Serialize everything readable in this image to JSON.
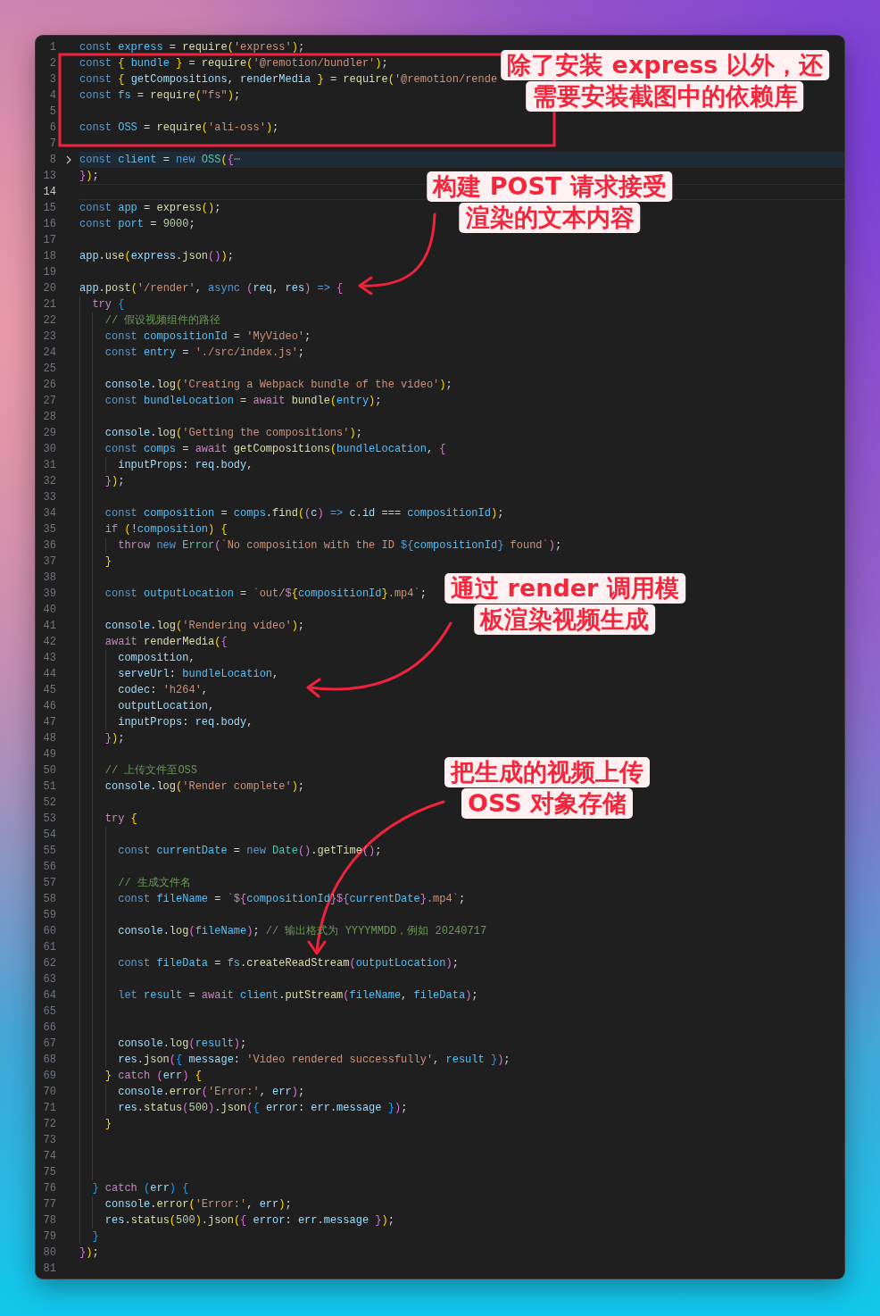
{
  "lines": [
    {
      "number": "1",
      "folded": false,
      "current": false,
      "tokens": [
        {
          "kind": "k",
          "text": "const "
        },
        {
          "kind": "n",
          "text": "express"
        },
        {
          "kind": "p",
          "text": " = "
        },
        {
          "kind": "f",
          "text": "require"
        },
        {
          "kind": "b1",
          "text": "("
        },
        {
          "kind": "s",
          "text": "'express'"
        },
        {
          "kind": "b1",
          "text": ")"
        },
        {
          "kind": "p",
          "text": ";"
        }
      ]
    },
    {
      "number": "2",
      "folded": false,
      "current": false,
      "tokens": [
        {
          "kind": "k",
          "text": "const "
        },
        {
          "kind": "b1",
          "text": "{ "
        },
        {
          "kind": "n",
          "text": "bundle "
        },
        {
          "kind": "b1",
          "text": "}"
        },
        {
          "kind": "p",
          "text": " = "
        },
        {
          "kind": "f",
          "text": "require"
        },
        {
          "kind": "b1",
          "text": "("
        },
        {
          "kind": "s",
          "text": "'@remotion/bundler'"
        },
        {
          "kind": "b1",
          "text": ")"
        },
        {
          "kind": "p",
          "text": ";"
        }
      ]
    },
    {
      "number": "3",
      "folded": false,
      "current": false,
      "tokens": [
        {
          "kind": "k",
          "text": "const "
        },
        {
          "kind": "b1",
          "text": "{ "
        },
        {
          "kind": "v",
          "text": "getCompositions"
        },
        {
          "kind": "p",
          "text": ", "
        },
        {
          "kind": "v",
          "text": "renderMedia "
        },
        {
          "kind": "b1",
          "text": "}"
        },
        {
          "kind": "p",
          "text": " = "
        },
        {
          "kind": "f",
          "text": "require"
        },
        {
          "kind": "b1",
          "text": "("
        },
        {
          "kind": "s",
          "text": "'@remotion/rende"
        }
      ]
    },
    {
      "number": "4",
      "folded": false,
      "current": false,
      "tokens": [
        {
          "kind": "k",
          "text": "const "
        },
        {
          "kind": "n",
          "text": "fs"
        },
        {
          "kind": "p",
          "text": " = "
        },
        {
          "kind": "f",
          "text": "require"
        },
        {
          "kind": "b1",
          "text": "("
        },
        {
          "kind": "s",
          "text": "\"fs\""
        },
        {
          "kind": "b1",
          "text": ")"
        },
        {
          "kind": "p",
          "text": ";"
        }
      ]
    },
    {
      "number": "5",
      "folded": false,
      "current": false
    },
    {
      "number": "6",
      "folded": false,
      "current": false,
      "tokens": [
        {
          "kind": "k",
          "text": "const "
        },
        {
          "kind": "n",
          "text": "OSS"
        },
        {
          "kind": "p",
          "text": " = "
        },
        {
          "kind": "f",
          "text": "require"
        },
        {
          "kind": "b1",
          "text": "("
        },
        {
          "kind": "s",
          "text": "'ali-oss'"
        },
        {
          "kind": "b1",
          "text": ")"
        },
        {
          "kind": "p",
          "text": ";"
        }
      ]
    },
    {
      "number": "7",
      "folded": false,
      "current": false
    },
    {
      "number": "8",
      "folded": true,
      "current": false,
      "tokens": [
        {
          "kind": "k",
          "text": "const "
        },
        {
          "kind": "n",
          "text": "client"
        },
        {
          "kind": "p",
          "text": " = "
        },
        {
          "kind": "k",
          "text": "new "
        },
        {
          "kind": "t",
          "text": "OSS"
        },
        {
          "kind": "b1",
          "text": "("
        },
        {
          "kind": "b2",
          "text": "{"
        },
        {
          "kind": "fold",
          "text": "⋯"
        }
      ]
    },
    {
      "number": "13",
      "folded": false,
      "current": false,
      "tokens": [
        {
          "kind": "b2",
          "text": "}"
        },
        {
          "kind": "b1",
          "text": ")"
        },
        {
          "kind": "p",
          "text": ";"
        }
      ]
    },
    {
      "number": "14",
      "folded": false,
      "current": true
    },
    {
      "number": "15",
      "folded": false,
      "current": false,
      "tokens": [
        {
          "kind": "k",
          "text": "const "
        },
        {
          "kind": "n",
          "text": "app"
        },
        {
          "kind": "p",
          "text": " = "
        },
        {
          "kind": "f",
          "text": "express"
        },
        {
          "kind": "b1",
          "text": "()"
        },
        {
          "kind": "p",
          "text": ";"
        }
      ]
    },
    {
      "number": "16",
      "folded": false,
      "current": false,
      "tokens": [
        {
          "kind": "k",
          "text": "const "
        },
        {
          "kind": "n",
          "text": "port"
        },
        {
          "kind": "p",
          "text": " = "
        },
        {
          "kind": "d",
          "text": "9000"
        },
        {
          "kind": "p",
          "text": ";"
        }
      ]
    },
    {
      "number": "17",
      "folded": false,
      "current": false
    },
    {
      "number": "18",
      "folded": false,
      "current": false,
      "tokens": [
        {
          "kind": "v",
          "text": "app"
        },
        {
          "kind": "p",
          "text": "."
        },
        {
          "kind": "f",
          "text": "use"
        },
        {
          "kind": "b1",
          "text": "("
        },
        {
          "kind": "v",
          "text": "express"
        },
        {
          "kind": "p",
          "text": "."
        },
        {
          "kind": "f",
          "text": "json"
        },
        {
          "kind": "b2",
          "text": "()"
        },
        {
          "kind": "b1",
          "text": ")"
        },
        {
          "kind": "p",
          "text": ";"
        }
      ]
    },
    {
      "number": "19",
      "folded": false,
      "current": false
    },
    {
      "number": "20",
      "folded": false,
      "current": false,
      "tokens": [
        {
          "kind": "v",
          "text": "app"
        },
        {
          "kind": "p",
          "text": "."
        },
        {
          "kind": "f",
          "text": "post"
        },
        {
          "kind": "b1",
          "text": "("
        },
        {
          "kind": "s",
          "text": "'/render'"
        },
        {
          "kind": "p",
          "text": ", "
        },
        {
          "kind": "k",
          "text": "async "
        },
        {
          "kind": "b2",
          "text": "("
        },
        {
          "kind": "v",
          "text": "req"
        },
        {
          "kind": "p",
          "text": ", "
        },
        {
          "kind": "v",
          "text": "res"
        },
        {
          "kind": "b2",
          "text": ") "
        },
        {
          "kind": "k",
          "text": "=> "
        },
        {
          "kind": "b2",
          "text": "{"
        }
      ]
    },
    {
      "number": "21",
      "folded": false,
      "current": false,
      "tokens": [
        {
          "kind": "c",
          "text": "  try "
        },
        {
          "kind": "b3",
          "text": "{"
        }
      ]
    },
    {
      "number": "22",
      "folded": false,
      "current": false,
      "tokens": [
        {
          "kind": "m",
          "text": "    // 假设视频组件的路径"
        }
      ]
    },
    {
      "number": "23",
      "folded": false,
      "current": false,
      "tokens": [
        {
          "kind": "k",
          "text": "    const "
        },
        {
          "kind": "n",
          "text": "compositionId"
        },
        {
          "kind": "p",
          "text": " = "
        },
        {
          "kind": "s",
          "text": "'MyVideo'"
        },
        {
          "kind": "p",
          "text": ";"
        }
      ]
    },
    {
      "number": "24",
      "folded": false,
      "current": false,
      "tokens": [
        {
          "kind": "k",
          "text": "    const "
        },
        {
          "kind": "n",
          "text": "entry"
        },
        {
          "kind": "p",
          "text": " = "
        },
        {
          "kind": "s",
          "text": "'./src/index.js'"
        },
        {
          "kind": "p",
          "text": ";"
        }
      ]
    },
    {
      "number": "25",
      "folded": false,
      "current": false
    },
    {
      "number": "26",
      "folded": false,
      "current": false,
      "tokens": [
        {
          "kind": "v",
          "text": "    console"
        },
        {
          "kind": "p",
          "text": "."
        },
        {
          "kind": "f",
          "text": "log"
        },
        {
          "kind": "b1",
          "text": "("
        },
        {
          "kind": "s",
          "text": "'Creating a Webpack bundle of the video'"
        },
        {
          "kind": "b1",
          "text": ")"
        },
        {
          "kind": "p",
          "text": ";"
        }
      ]
    },
    {
      "number": "27",
      "folded": false,
      "current": false,
      "tokens": [
        {
          "kind": "k",
          "text": "    const "
        },
        {
          "kind": "n",
          "text": "bundleLocation"
        },
        {
          "kind": "p",
          "text": " = "
        },
        {
          "kind": "c",
          "text": "await "
        },
        {
          "kind": "f",
          "text": "bundle"
        },
        {
          "kind": "b1",
          "text": "("
        },
        {
          "kind": "n",
          "text": "entry"
        },
        {
          "kind": "b1",
          "text": ")"
        },
        {
          "kind": "p",
          "text": ";"
        }
      ]
    },
    {
      "number": "28",
      "folded": false,
      "current": false
    },
    {
      "number": "29",
      "folded": false,
      "current": false,
      "tokens": [
        {
          "kind": "v",
          "text": "    console"
        },
        {
          "kind": "p",
          "text": "."
        },
        {
          "kind": "f",
          "text": "log"
        },
        {
          "kind": "b1",
          "text": "("
        },
        {
          "kind": "s",
          "text": "'Getting the compositions'"
        },
        {
          "kind": "b1",
          "text": ")"
        },
        {
          "kind": "p",
          "text": ";"
        }
      ]
    },
    {
      "number": "30",
      "folded": false,
      "current": false,
      "tokens": [
        {
          "kind": "k",
          "text": "    const "
        },
        {
          "kind": "n",
          "text": "comps"
        },
        {
          "kind": "p",
          "text": " = "
        },
        {
          "kind": "c",
          "text": "await "
        },
        {
          "kind": "f",
          "text": "getCompositions"
        },
        {
          "kind": "b1",
          "text": "("
        },
        {
          "kind": "n",
          "text": "bundleLocation"
        },
        {
          "kind": "p",
          "text": ", "
        },
        {
          "kind": "b2",
          "text": "{"
        }
      ]
    },
    {
      "number": "31",
      "folded": false,
      "current": false,
      "tokens": [
        {
          "kind": "v",
          "text": "      inputProps"
        },
        {
          "kind": "p",
          "text": ": "
        },
        {
          "kind": "v",
          "text": "req"
        },
        {
          "kind": "p",
          "text": "."
        },
        {
          "kind": "v",
          "text": "body"
        },
        {
          "kind": "p",
          "text": ","
        }
      ]
    },
    {
      "number": "32",
      "folded": false,
      "current": false,
      "tokens": [
        {
          "kind": "b2",
          "text": "    }"
        },
        {
          "kind": "b1",
          "text": ")"
        },
        {
          "kind": "p",
          "text": ";"
        }
      ]
    },
    {
      "number": "33",
      "folded": false,
      "current": false
    },
    {
      "number": "34",
      "folded": false,
      "current": false,
      "tokens": [
        {
          "kind": "k",
          "text": "    const "
        },
        {
          "kind": "n",
          "text": "composition"
        },
        {
          "kind": "p",
          "text": " = "
        },
        {
          "kind": "n",
          "text": "comps"
        },
        {
          "kind": "p",
          "text": "."
        },
        {
          "kind": "f",
          "text": "find"
        },
        {
          "kind": "b1",
          "text": "("
        },
        {
          "kind": "b2",
          "text": "("
        },
        {
          "kind": "v",
          "text": "c"
        },
        {
          "kind": "b2",
          "text": ") "
        },
        {
          "kind": "k",
          "text": "=> "
        },
        {
          "kind": "v",
          "text": "c"
        },
        {
          "kind": "p",
          "text": "."
        },
        {
          "kind": "v",
          "text": "id"
        },
        {
          "kind": "p",
          "text": " === "
        },
        {
          "kind": "n",
          "text": "compositionId"
        },
        {
          "kind": "b1",
          "text": ")"
        },
        {
          "kind": "p",
          "text": ";"
        }
      ]
    },
    {
      "number": "35",
      "folded": false,
      "current": false,
      "tokens": [
        {
          "kind": "c",
          "text": "    if "
        },
        {
          "kind": "b1",
          "text": "("
        },
        {
          "kind": "p",
          "text": "!"
        },
        {
          "kind": "n",
          "text": "composition"
        },
        {
          "kind": "b1",
          "text": ") {"
        }
      ]
    },
    {
      "number": "36",
      "folded": false,
      "current": false,
      "tokens": [
        {
          "kind": "c",
          "text": "      throw "
        },
        {
          "kind": "k",
          "text": "new "
        },
        {
          "kind": "t",
          "text": "Error"
        },
        {
          "kind": "b2",
          "text": "("
        },
        {
          "kind": "s",
          "text": "`No composition with the ID "
        },
        {
          "kind": "k",
          "text": "${"
        },
        {
          "kind": "n",
          "text": "compositionId"
        },
        {
          "kind": "k",
          "text": "}"
        },
        {
          "kind": "s",
          "text": " found`"
        },
        {
          "kind": "b2",
          "text": ")"
        },
        {
          "kind": "p",
          "text": ";"
        }
      ]
    },
    {
      "number": "37",
      "folded": false,
      "current": false,
      "tokens": [
        {
          "kind": "b1",
          "text": "    }"
        }
      ]
    },
    {
      "number": "38",
      "folded": false,
      "current": false
    },
    {
      "number": "39",
      "folded": false,
      "current": false,
      "tokens": [
        {
          "kind": "k",
          "text": "    const "
        },
        {
          "kind": "n",
          "text": "outputLocation"
        },
        {
          "kind": "p",
          "text": " = "
        },
        {
          "kind": "s",
          "text": "`out/"
        },
        {
          "kind": "c",
          "text": "$"
        },
        {
          "kind": "b1",
          "text": "{"
        },
        {
          "kind": "n",
          "text": "compositionId"
        },
        {
          "kind": "b1",
          "text": "}"
        },
        {
          "kind": "s",
          "text": ".mp4`"
        },
        {
          "kind": "p",
          "text": ";"
        }
      ]
    },
    {
      "number": "40",
      "folded": false,
      "current": false
    },
    {
      "number": "41",
      "folded": false,
      "current": false,
      "tokens": [
        {
          "kind": "v",
          "text": "    console"
        },
        {
          "kind": "p",
          "text": "."
        },
        {
          "kind": "f",
          "text": "log"
        },
        {
          "kind": "b1",
          "text": "("
        },
        {
          "kind": "s",
          "text": "'Rendering video'"
        },
        {
          "kind": "b1",
          "text": ")"
        },
        {
          "kind": "p",
          "text": ";"
        }
      ]
    },
    {
      "number": "42",
      "folded": false,
      "current": false,
      "tokens": [
        {
          "kind": "c",
          "text": "    await "
        },
        {
          "kind": "f",
          "text": "renderMedia"
        },
        {
          "kind": "b1",
          "text": "("
        },
        {
          "kind": "b2",
          "text": "{"
        }
      ]
    },
    {
      "number": "43",
      "folded": false,
      "current": false,
      "tokens": [
        {
          "kind": "v",
          "text": "      composition"
        },
        {
          "kind": "p",
          "text": ","
        }
      ]
    },
    {
      "number": "44",
      "folded": false,
      "current": false,
      "tokens": [
        {
          "kind": "v",
          "text": "      serveUrl"
        },
        {
          "kind": "p",
          "text": ": "
        },
        {
          "kind": "n",
          "text": "bundleLocation"
        },
        {
          "kind": "p",
          "text": ","
        }
      ]
    },
    {
      "number": "45",
      "folded": false,
      "current": false,
      "tokens": [
        {
          "kind": "v",
          "text": "      codec"
        },
        {
          "kind": "p",
          "text": ": "
        },
        {
          "kind": "s",
          "text": "'h264'"
        },
        {
          "kind": "p",
          "text": ","
        }
      ]
    },
    {
      "number": "46",
      "folded": false,
      "current": false,
      "tokens": [
        {
          "kind": "v",
          "text": "      outputLocation"
        },
        {
          "kind": "p",
          "text": ","
        }
      ]
    },
    {
      "number": "47",
      "folded": false,
      "current": false,
      "tokens": [
        {
          "kind": "v",
          "text": "      inputProps"
        },
        {
          "kind": "p",
          "text": ": "
        },
        {
          "kind": "v",
          "text": "req"
        },
        {
          "kind": "p",
          "text": "."
        },
        {
          "kind": "v",
          "text": "body"
        },
        {
          "kind": "p",
          "text": ","
        }
      ]
    },
    {
      "number": "48",
      "folded": false,
      "current": false,
      "tokens": [
        {
          "kind": "b2",
          "text": "    }"
        },
        {
          "kind": "b1",
          "text": ")"
        },
        {
          "kind": "p",
          "text": ";"
        }
      ]
    },
    {
      "number": "49",
      "folded": false,
      "current": false
    },
    {
      "number": "50",
      "folded": false,
      "current": false,
      "tokens": [
        {
          "kind": "m",
          "text": "    // 上传文件至OSS"
        }
      ]
    },
    {
      "number": "51",
      "folded": false,
      "current": false,
      "tokens": [
        {
          "kind": "v",
          "text": "    console"
        },
        {
          "kind": "p",
          "text": "."
        },
        {
          "kind": "f",
          "text": "log"
        },
        {
          "kind": "b1",
          "text": "("
        },
        {
          "kind": "s",
          "text": "'Render complete'"
        },
        {
          "kind": "b1",
          "text": ")"
        },
        {
          "kind": "p",
          "text": ";"
        }
      ]
    },
    {
      "number": "52",
      "folded": false,
      "current": false
    },
    {
      "number": "53",
      "folded": false,
      "current": false,
      "tokens": [
        {
          "kind": "c",
          "text": "    try "
        },
        {
          "kind": "b1",
          "text": "{"
        }
      ]
    },
    {
      "number": "54",
      "folded": false,
      "current": false
    },
    {
      "number": "55",
      "folded": false,
      "current": false,
      "tokens": [
        {
          "kind": "k",
          "text": "      const "
        },
        {
          "kind": "n",
          "text": "currentDate"
        },
        {
          "kind": "p",
          "text": " = "
        },
        {
          "kind": "k",
          "text": "new "
        },
        {
          "kind": "t",
          "text": "Date"
        },
        {
          "kind": "b2",
          "text": "()"
        },
        {
          "kind": "p",
          "text": "."
        },
        {
          "kind": "f",
          "text": "getTime"
        },
        {
          "kind": "b2",
          "text": "()"
        },
        {
          "kind": "p",
          "text": ";"
        }
      ]
    },
    {
      "number": "56",
      "folded": false,
      "current": false
    },
    {
      "number": "57",
      "folded": false,
      "current": false,
      "tokens": [
        {
          "kind": "m",
          "text": "      // 生成文件名"
        }
      ]
    },
    {
      "number": "58",
      "folded": false,
      "current": false,
      "tokens": [
        {
          "kind": "k",
          "text": "      const "
        },
        {
          "kind": "n",
          "text": "fileName"
        },
        {
          "kind": "p",
          "text": " = "
        },
        {
          "kind": "s",
          "text": "`"
        },
        {
          "kind": "c",
          "text": "${"
        },
        {
          "kind": "n",
          "text": "compositionId"
        },
        {
          "kind": "c",
          "text": "}${"
        },
        {
          "kind": "n",
          "text": "currentDate"
        },
        {
          "kind": "c",
          "text": "}"
        },
        {
          "kind": "s",
          "text": ".mp4`"
        },
        {
          "kind": "p",
          "text": ";"
        }
      ]
    },
    {
      "number": "59",
      "folded": false,
      "current": false
    },
    {
      "number": "60",
      "folded": false,
      "current": false,
      "tokens": [
        {
          "kind": "v",
          "text": "      console"
        },
        {
          "kind": "p",
          "text": "."
        },
        {
          "kind": "f",
          "text": "log"
        },
        {
          "kind": "b2",
          "text": "("
        },
        {
          "kind": "n",
          "text": "fileName"
        },
        {
          "kind": "b2",
          "text": ")"
        },
        {
          "kind": "p",
          "text": "; "
        },
        {
          "kind": "m",
          "text": "// 输出格式为 YYYYMMDD，例如 20240717"
        }
      ]
    },
    {
      "number": "61",
      "folded": false,
      "current": false
    },
    {
      "number": "62",
      "folded": false,
      "current": false,
      "tokens": [
        {
          "kind": "k",
          "text": "      const "
        },
        {
          "kind": "n",
          "text": "fileData"
        },
        {
          "kind": "p",
          "text": " = "
        },
        {
          "kind": "n",
          "text": "fs"
        },
        {
          "kind": "p",
          "text": "."
        },
        {
          "kind": "f",
          "text": "createReadStream"
        },
        {
          "kind": "b2",
          "text": "("
        },
        {
          "kind": "n",
          "text": "outputLocation"
        },
        {
          "kind": "b2",
          "text": ")"
        },
        {
          "kind": "p",
          "text": ";"
        }
      ]
    },
    {
      "number": "63",
      "folded": false,
      "current": false
    },
    {
      "number": "64",
      "folded": false,
      "current": false,
      "tokens": [
        {
          "kind": "k",
          "text": "      let "
        },
        {
          "kind": "n",
          "text": "result"
        },
        {
          "kind": "p",
          "text": " = "
        },
        {
          "kind": "c",
          "text": "await "
        },
        {
          "kind": "n",
          "text": "client"
        },
        {
          "kind": "p",
          "text": "."
        },
        {
          "kind": "f",
          "text": "putStream"
        },
        {
          "kind": "b2",
          "text": "("
        },
        {
          "kind": "n",
          "text": "fileName"
        },
        {
          "kind": "p",
          "text": ", "
        },
        {
          "kind": "n",
          "text": "fileData"
        },
        {
          "kind": "b2",
          "text": ")"
        },
        {
          "kind": "p",
          "text": ";"
        }
      ]
    },
    {
      "number": "65",
      "folded": false,
      "current": false
    },
    {
      "number": "66",
      "folded": false,
      "current": false
    },
    {
      "number": "67",
      "folded": false,
      "current": false,
      "tokens": [
        {
          "kind": "v",
          "text": "      console"
        },
        {
          "kind": "p",
          "text": "."
        },
        {
          "kind": "f",
          "text": "log"
        },
        {
          "kind": "b2",
          "text": "("
        },
        {
          "kind": "n",
          "text": "result"
        },
        {
          "kind": "b2",
          "text": ")"
        },
        {
          "kind": "p",
          "text": ";"
        }
      ]
    },
    {
      "number": "68",
      "folded": false,
      "current": false,
      "tokens": [
        {
          "kind": "v",
          "text": "      res"
        },
        {
          "kind": "p",
          "text": "."
        },
        {
          "kind": "f",
          "text": "json"
        },
        {
          "kind": "b2",
          "text": "("
        },
        {
          "kind": "b3",
          "text": "{ "
        },
        {
          "kind": "v",
          "text": "message"
        },
        {
          "kind": "p",
          "text": ": "
        },
        {
          "kind": "s",
          "text": "'Video rendered successfully'"
        },
        {
          "kind": "p",
          "text": ", "
        },
        {
          "kind": "n",
          "text": "result "
        },
        {
          "kind": "b3",
          "text": "}"
        },
        {
          "kind": "b2",
          "text": ")"
        },
        {
          "kind": "p",
          "text": ";"
        }
      ]
    },
    {
      "number": "69",
      "folded": false,
      "current": false,
      "tokens": [
        {
          "kind": "b1",
          "text": "    } "
        },
        {
          "kind": "c",
          "text": "catch "
        },
        {
          "kind": "b2",
          "text": "("
        },
        {
          "kind": "v",
          "text": "err"
        },
        {
          "kind": "b2",
          "text": ") "
        },
        {
          "kind": "b1",
          "text": "{"
        }
      ]
    },
    {
      "number": "70",
      "folded": false,
      "current": false,
      "tokens": [
        {
          "kind": "v",
          "text": "      console"
        },
        {
          "kind": "p",
          "text": "."
        },
        {
          "kind": "f",
          "text": "error"
        },
        {
          "kind": "b2",
          "text": "("
        },
        {
          "kind": "s",
          "text": "'Error:'"
        },
        {
          "kind": "p",
          "text": ", "
        },
        {
          "kind": "v",
          "text": "err"
        },
        {
          "kind": "b2",
          "text": ")"
        },
        {
          "kind": "p",
          "text": ";"
        }
      ]
    },
    {
      "number": "71",
      "folded": false,
      "current": false,
      "tokens": [
        {
          "kind": "v",
          "text": "      res"
        },
        {
          "kind": "p",
          "text": "."
        },
        {
          "kind": "f",
          "text": "status"
        },
        {
          "kind": "b2",
          "text": "("
        },
        {
          "kind": "d",
          "text": "500"
        },
        {
          "kind": "b2",
          "text": ")"
        },
        {
          "kind": "p",
          "text": "."
        },
        {
          "kind": "f",
          "text": "json"
        },
        {
          "kind": "b2",
          "text": "("
        },
        {
          "kind": "b3",
          "text": "{ "
        },
        {
          "kind": "v",
          "text": "error"
        },
        {
          "kind": "p",
          "text": ": "
        },
        {
          "kind": "v",
          "text": "err"
        },
        {
          "kind": "p",
          "text": "."
        },
        {
          "kind": "v",
          "text": "message "
        },
        {
          "kind": "b3",
          "text": "}"
        },
        {
          "kind": "b2",
          "text": ")"
        },
        {
          "kind": "p",
          "text": ";"
        }
      ]
    },
    {
      "number": "72",
      "folded": false,
      "current": false,
      "tokens": [
        {
          "kind": "b1",
          "text": "    }"
        }
      ]
    },
    {
      "number": "73",
      "folded": false,
      "current": false
    },
    {
      "number": "74",
      "folded": false,
      "current": false
    },
    {
      "number": "75",
      "folded": false,
      "current": false
    },
    {
      "number": "76",
      "folded": false,
      "current": false,
      "tokens": [
        {
          "kind": "b3",
          "text": "  } "
        },
        {
          "kind": "c",
          "text": "catch "
        },
        {
          "kind": "b3",
          "text": "("
        },
        {
          "kind": "v",
          "text": "err"
        },
        {
          "kind": "b3",
          "text": ") {"
        }
      ]
    },
    {
      "number": "77",
      "folded": false,
      "current": false,
      "tokens": [
        {
          "kind": "v",
          "text": "    console"
        },
        {
          "kind": "p",
          "text": "."
        },
        {
          "kind": "f",
          "text": "error"
        },
        {
          "kind": "b1",
          "text": "("
        },
        {
          "kind": "s",
          "text": "'Error:'"
        },
        {
          "kind": "p",
          "text": ", "
        },
        {
          "kind": "v",
          "text": "err"
        },
        {
          "kind": "b1",
          "text": ")"
        },
        {
          "kind": "p",
          "text": ";"
        }
      ]
    },
    {
      "number": "78",
      "folded": false,
      "current": false,
      "tokens": [
        {
          "kind": "v",
          "text": "    res"
        },
        {
          "kind": "p",
          "text": "."
        },
        {
          "kind": "f",
          "text": "status"
        },
        {
          "kind": "b1",
          "text": "("
        },
        {
          "kind": "d",
          "text": "500"
        },
        {
          "kind": "b1",
          "text": ")"
        },
        {
          "kind": "p",
          "text": "."
        },
        {
          "kind": "f",
          "text": "json"
        },
        {
          "kind": "b1",
          "text": "("
        },
        {
          "kind": "b2",
          "text": "{ "
        },
        {
          "kind": "v",
          "text": "error"
        },
        {
          "kind": "p",
          "text": ": "
        },
        {
          "kind": "v",
          "text": "err"
        },
        {
          "kind": "p",
          "text": "."
        },
        {
          "kind": "v",
          "text": "message "
        },
        {
          "kind": "b2",
          "text": "}"
        },
        {
          "kind": "b1",
          "text": ")"
        },
        {
          "kind": "p",
          "text": ";"
        }
      ]
    },
    {
      "number": "79",
      "folded": false,
      "current": false,
      "tokens": [
        {
          "kind": "b3",
          "text": "  }"
        }
      ]
    },
    {
      "number": "80",
      "folded": false,
      "current": false,
      "tokens": [
        {
          "kind": "b2",
          "text": "}"
        },
        {
          "kind": "b1",
          "text": ")"
        },
        {
          "kind": "p",
          "text": ";"
        }
      ]
    },
    {
      "number": "81",
      "folded": false,
      "current": false
    }
  ],
  "annotations": [
    {
      "kind": "boxed",
      "lines": [
        "除了安装 express 以外，还",
        "需要安装截图中的依赖库"
      ]
    },
    {
      "kind": "arrow",
      "lines": [
        "构建 POST 请求接受",
        "渲染的文本内容"
      ]
    },
    {
      "kind": "arrow",
      "lines": [
        "通过 render 调用模",
        "板渲染视频生成"
      ]
    },
    {
      "kind": "arrow",
      "lines": [
        "把生成的视频上传",
        "OSS 对象存储"
      ]
    }
  ]
}
